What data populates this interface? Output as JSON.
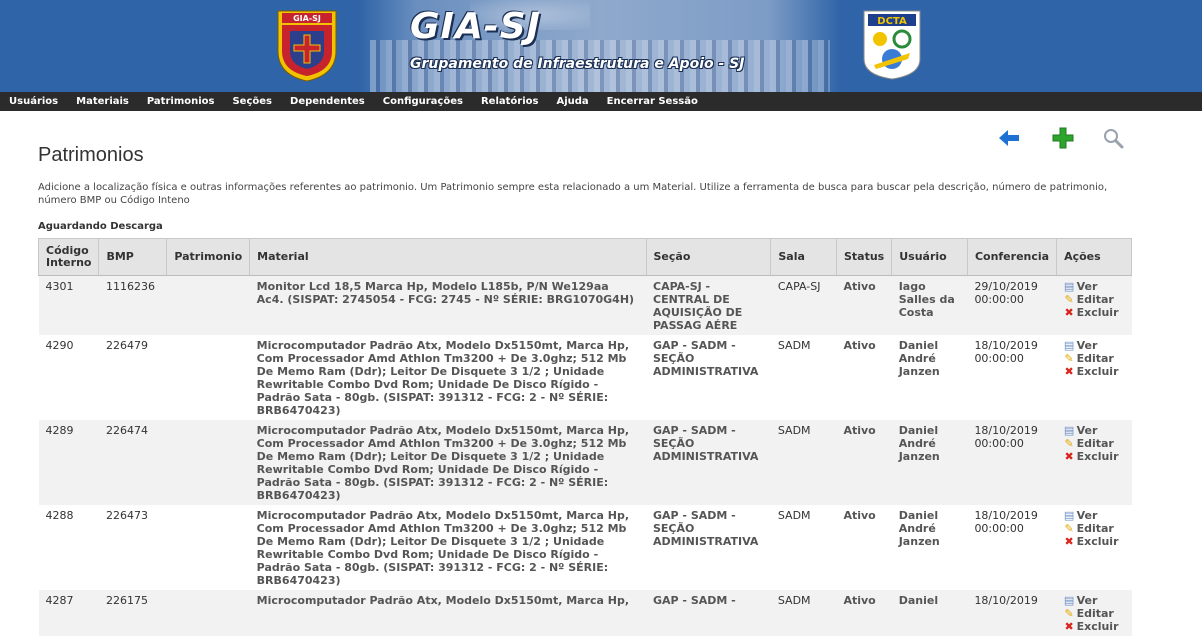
{
  "header": {
    "title": "GIA-SJ",
    "subtitle": "Grupamento de Infraestrutura e Apoio - SJ",
    "crest_label": "GIA-SJ",
    "dcta_label": "DCTA",
    "colors": {
      "banner": "#2f65a8",
      "nav": "#2b2b2b"
    }
  },
  "nav": {
    "items": [
      "Usuários",
      "Materiais",
      "Patrimonios",
      "Seções",
      "Dependentes",
      "Configurações",
      "Relatórios",
      "Ajuda",
      "Encerrar Sessão"
    ]
  },
  "toolbar": {
    "back_icon": "arrow-left-icon",
    "add_icon": "plus-icon",
    "search_icon": "search-icon"
  },
  "page": {
    "title": "Patrimonios",
    "intro": "Adicione a localização física e outras informações referentes ao patrimonio. Um Patrimonio sempre esta relacionado a um Material. Utilize a ferramenta de busca para buscar pela descrição, número de patrimonio, número BMP ou Código Inteno",
    "section": "Aguardando Descarga"
  },
  "table": {
    "headers": [
      "Código Interno",
      "BMP",
      "Patrimonio",
      "Material",
      "Seção",
      "Sala",
      "Status",
      "Usuário",
      "Conferencia",
      "Ações"
    ],
    "actions": {
      "view": "Ver",
      "edit": "Editar",
      "delete": "Excluir"
    },
    "rows": [
      {
        "codigo": "4301",
        "bmp": "1116236",
        "patrimonio": "",
        "material": "Monitor Lcd 18,5 Marca Hp, Modelo L185b, P/N We129aa Ac4. (SISPAT: 2745054 - FCG: 2745 - Nº SÉRIE: BRG1070G4H)",
        "secao": "CAPA-SJ - CENTRAL DE AQUISIÇÃO DE PASSAG AÉRE",
        "sala": "CAPA-SJ",
        "status": "Ativo",
        "usuario": "Iago Salles da Costa",
        "conferencia": "29/10/2019 00:00:00"
      },
      {
        "codigo": "4290",
        "bmp": "226479",
        "patrimonio": "",
        "material": "Microcomputador Padrão Atx, Modelo Dx5150mt, Marca Hp, Com Processador Amd Athlon Tm3200 + De 3.0ghz; 512 Mb De Memo Ram (Ddr); Leitor De Disquete 3 1/2 ; Unidade Rewritable Combo Dvd Rom; Unidade De Disco Rígido - Padrão Sata - 80gb. (SISPAT: 391312 - FCG: 2 - Nº SÉRIE: BRB6470423)",
        "secao": "GAP - SADM - SEÇÃO ADMINISTRATIVA",
        "sala": "SADM",
        "status": "Ativo",
        "usuario": "Daniel André Janzen",
        "conferencia": "18/10/2019 00:00:00"
      },
      {
        "codigo": "4289",
        "bmp": "226474",
        "patrimonio": "",
        "material": "Microcomputador Padrão Atx, Modelo Dx5150mt, Marca Hp, Com Processador Amd Athlon Tm3200 + De 3.0ghz; 512 Mb De Memo Ram (Ddr); Leitor De Disquete 3 1/2 ; Unidade Rewritable Combo Dvd Rom; Unidade De Disco Rígido - Padrão Sata - 80gb. (SISPAT: 391312 - FCG: 2 - Nº SÉRIE: BRB6470423)",
        "secao": "GAP - SADM - SEÇÃO ADMINISTRATIVA",
        "sala": "SADM",
        "status": "Ativo",
        "usuario": "Daniel André Janzen",
        "conferencia": "18/10/2019 00:00:00"
      },
      {
        "codigo": "4288",
        "bmp": "226473",
        "patrimonio": "",
        "material": "Microcomputador Padrão Atx, Modelo Dx5150mt, Marca Hp, Com Processador Amd Athlon Tm3200 + De 3.0ghz; 512 Mb De Memo Ram (Ddr); Leitor De Disquete 3 1/2 ; Unidade Rewritable Combo Dvd Rom; Unidade De Disco Rígido - Padrão Sata - 80gb. (SISPAT: 391312 - FCG: 2 - Nº SÉRIE: BRB6470423)",
        "secao": "GAP - SADM - SEÇÃO ADMINISTRATIVA",
        "sala": "SADM",
        "status": "Ativo",
        "usuario": "Daniel André Janzen",
        "conferencia": "18/10/2019 00:00:00"
      },
      {
        "codigo": "4287",
        "bmp": "226175",
        "patrimonio": "",
        "material": "Microcomputador Padrão Atx, Modelo Dx5150mt, Marca Hp,",
        "secao": "GAP - SADM -",
        "sala": "SADM",
        "status": "Ativo",
        "usuario": "Daniel",
        "conferencia": "18/10/2019"
      }
    ]
  }
}
